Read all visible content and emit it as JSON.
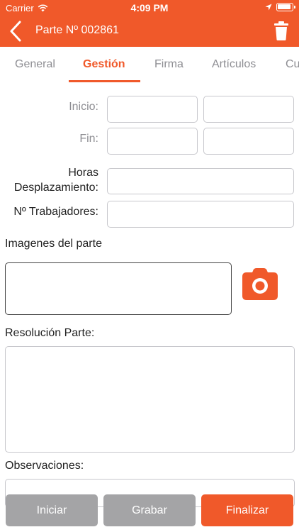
{
  "status_bar": {
    "carrier": "Carrier",
    "time": "4:09 PM"
  },
  "nav": {
    "title": "Parte Nº 002861",
    "back_icon": "chevron-left-icon",
    "trash_icon": "trash-icon"
  },
  "tabs": [
    {
      "label": "General",
      "active": false
    },
    {
      "label": "Gestión",
      "active": true
    },
    {
      "label": "Firma",
      "active": false
    },
    {
      "label": "Artículos",
      "active": false
    },
    {
      "label": "Cu",
      "active": false
    }
  ],
  "form": {
    "inicio_label": "Inicio:",
    "fin_label": "Fin:",
    "horas_label_1": "Horas",
    "horas_label_2": "Desplazamiento:",
    "trabajadores_label": "Nº Trabajadores:",
    "imagenes_label": "Imagenes del parte",
    "resolucion_label": "Resolución Parte:",
    "observaciones_label": "Observaciones:"
  },
  "buttons": {
    "iniciar": "Iniciar",
    "grabar": "Grabar",
    "finalizar": "Finalizar"
  },
  "colors": {
    "accent": "#f0592a",
    "button_gray": "#a4a4a6",
    "muted_text": "#8e8e93"
  }
}
